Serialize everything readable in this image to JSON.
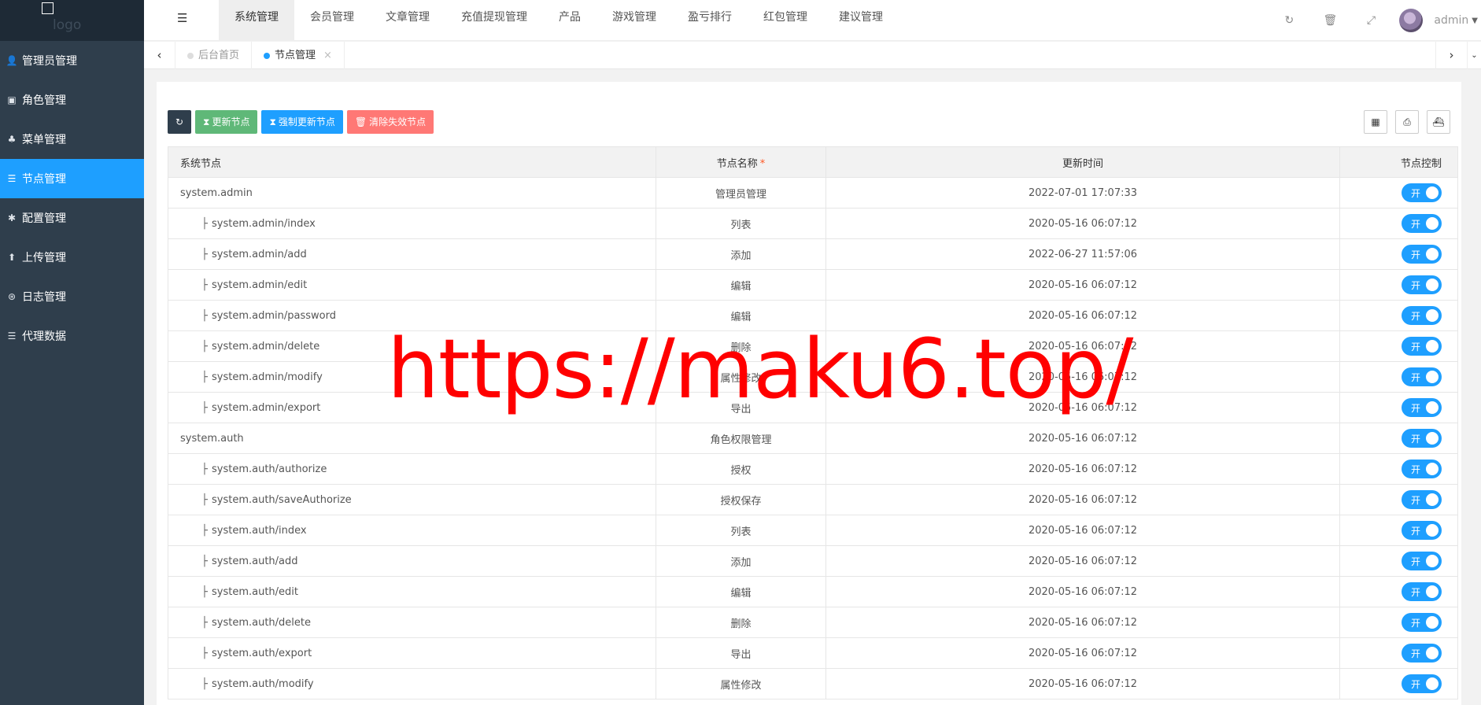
{
  "sidebar": {
    "logo_text": "logo",
    "items": [
      {
        "label": "管理员管理",
        "icon": "user-icon",
        "glyph": "👤"
      },
      {
        "label": "角色管理",
        "icon": "role-icon",
        "glyph": "▣"
      },
      {
        "label": "菜单管理",
        "icon": "tree-icon",
        "glyph": "♣"
      },
      {
        "label": "节点管理",
        "icon": "list-icon",
        "glyph": "☰",
        "active": true
      },
      {
        "label": "配置管理",
        "icon": "gear-icon",
        "glyph": "✱"
      },
      {
        "label": "上传管理",
        "icon": "upload-icon",
        "glyph": "⬆"
      },
      {
        "label": "日志管理",
        "icon": "log-icon",
        "glyph": "⊛"
      },
      {
        "label": "代理数据",
        "icon": "list-icon",
        "glyph": "☰"
      }
    ]
  },
  "header": {
    "toggle_glyph": "☰",
    "nav": [
      "系统管理",
      "会员管理",
      "文章管理",
      "充值提现管理",
      "产品",
      "游戏管理",
      "盈亏排行",
      "红包管理",
      "建议管理"
    ],
    "active_nav": 0,
    "icons": {
      "refresh": "↻",
      "clear": "🗑",
      "fullscreen": "⤢"
    },
    "user_name": "admin",
    "caret": "▼"
  },
  "tabs": {
    "left_arrow": "‹",
    "right_arrow": "›",
    "more": "⌄",
    "items": [
      {
        "label": "后台首页",
        "active": false
      },
      {
        "label": "节点管理",
        "active": true,
        "close": "×"
      }
    ]
  },
  "toolbar": {
    "refresh_glyph": "↻",
    "buttons": [
      {
        "label": "更新节点",
        "glyph": "⧗"
      },
      {
        "label": "强制更新节点",
        "glyph": "⧗"
      },
      {
        "label": "清除失效节点",
        "glyph": "🗑"
      }
    ],
    "right_tools": [
      {
        "name": "columns-icon",
        "glyph": "▦"
      },
      {
        "name": "print-icon",
        "glyph": "⎙"
      },
      {
        "name": "export-icon",
        "glyph": "⛴"
      }
    ]
  },
  "table": {
    "headers": [
      "系统节点",
      "节点名称",
      "更新时间",
      "节点控制"
    ],
    "required_mark": "*",
    "branch_glyph": "├",
    "switch_label": "开",
    "rows": [
      {
        "node": "system.admin",
        "child": false,
        "name": "管理员管理",
        "time": "2022-07-01 17:07:33"
      },
      {
        "node": "system.admin/index",
        "child": true,
        "name": "列表",
        "time": "2020-05-16 06:07:12"
      },
      {
        "node": "system.admin/add",
        "child": true,
        "name": "添加",
        "time": "2022-06-27 11:57:06"
      },
      {
        "node": "system.admin/edit",
        "child": true,
        "name": "编辑",
        "time": "2020-05-16 06:07:12"
      },
      {
        "node": "system.admin/password",
        "child": true,
        "name": "编辑",
        "time": "2020-05-16 06:07:12"
      },
      {
        "node": "system.admin/delete",
        "child": true,
        "name": "删除",
        "time": "2020-05-16 06:07:12"
      },
      {
        "node": "system.admin/modify",
        "child": true,
        "name": "属性修改",
        "time": "2020-05-16 06:07:12"
      },
      {
        "node": "system.admin/export",
        "child": true,
        "name": "导出",
        "time": "2020-05-16 06:07:12"
      },
      {
        "node": "system.auth",
        "child": false,
        "name": "角色权限管理",
        "time": "2020-05-16 06:07:12"
      },
      {
        "node": "system.auth/authorize",
        "child": true,
        "name": "授权",
        "time": "2020-05-16 06:07:12"
      },
      {
        "node": "system.auth/saveAuthorize",
        "child": true,
        "name": "授权保存",
        "time": "2020-05-16 06:07:12"
      },
      {
        "node": "system.auth/index",
        "child": true,
        "name": "列表",
        "time": "2020-05-16 06:07:12"
      },
      {
        "node": "system.auth/add",
        "child": true,
        "name": "添加",
        "time": "2020-05-16 06:07:12"
      },
      {
        "node": "system.auth/edit",
        "child": true,
        "name": "编辑",
        "time": "2020-05-16 06:07:12"
      },
      {
        "node": "system.auth/delete",
        "child": true,
        "name": "删除",
        "time": "2020-05-16 06:07:12"
      },
      {
        "node": "system.auth/export",
        "child": true,
        "name": "导出",
        "time": "2020-05-16 06:07:12"
      },
      {
        "node": "system.auth/modify",
        "child": true,
        "name": "属性修改",
        "time": "2020-05-16 06:07:12"
      }
    ]
  },
  "watermark": "https://maku6.top/",
  "colors": {
    "sidebar": "#2f3e4c",
    "accent": "#1e9fff",
    "green": "#5fb878",
    "red": "#ff7875",
    "watermark": "#ff0000"
  }
}
